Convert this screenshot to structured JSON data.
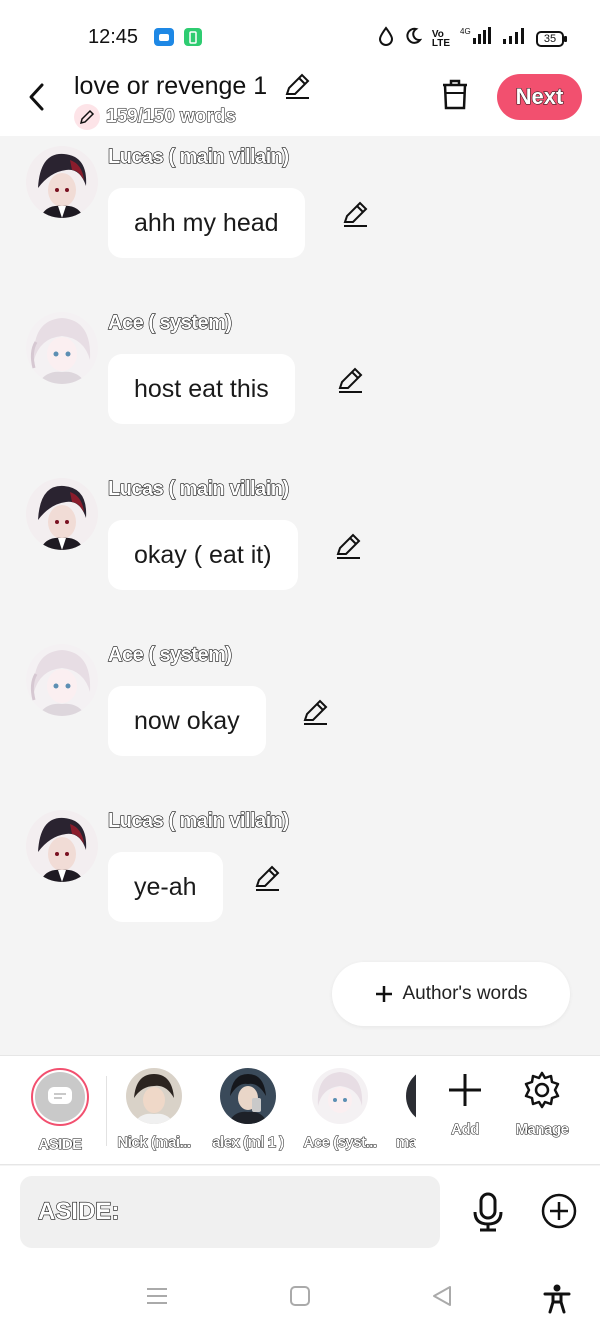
{
  "status_bar": {
    "time": "12:45",
    "battery": "35"
  },
  "header": {
    "title": "love or revenge 1",
    "word_count": "159/150 words",
    "next_label": "Next",
    "accent_color": "#f2506f"
  },
  "messages": [
    {
      "speaker": "Lucas ( main villain)",
      "text": "ahh my head",
      "avatar": "lucas"
    },
    {
      "speaker": "Ace ( system)",
      "text": "host eat this",
      "avatar": "ace"
    },
    {
      "speaker": "Lucas ( main villain)",
      "text": "okay ( eat it)",
      "avatar": "lucas"
    },
    {
      "speaker": "Ace ( system)",
      "text": "now okay",
      "avatar": "ace"
    },
    {
      "speaker": "Lucas ( main villain)",
      "text": "ye-ah",
      "avatar": "lucas"
    }
  ],
  "authors_words_label": "Author's words",
  "characters": [
    {
      "label": "ASIDE"
    },
    {
      "label": "Nick (mai..."
    },
    {
      "label": "alex (ml 1 )"
    },
    {
      "label": "Ace (syst..."
    },
    {
      "label": "ma"
    }
  ],
  "tools": {
    "add_label": "Add",
    "manage_label": "Manage"
  },
  "input": {
    "value": "ASIDE:"
  }
}
